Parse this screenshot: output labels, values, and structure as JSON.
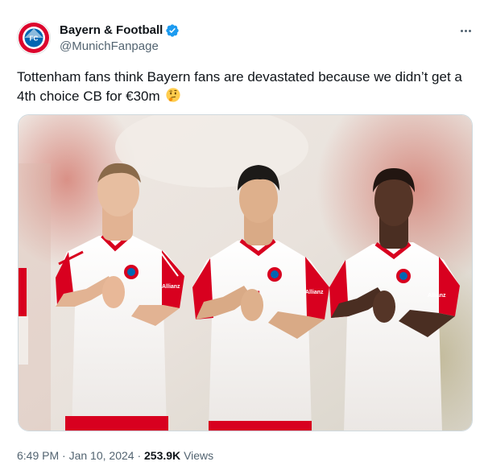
{
  "account": {
    "display_name": "Bayern & Football",
    "handle": "@MunichFanpage",
    "verified": true,
    "avatar_icon": "fc-bayern-crest-icon"
  },
  "tweet": {
    "text": "Tottenham fans think Bayern fans are devastated because we didn’t get a 4th choice CB for €30m",
    "emoji": "thinking-face-icon"
  },
  "media": {
    "description_icon": "three-players-in-red-white-kits-photo",
    "shirt_sponsor": "Allianz"
  },
  "meta": {
    "time": "6:49 PM",
    "separator": "·",
    "date": "Jan 10, 2024",
    "views_count": "253.9K",
    "views_label": "Views"
  },
  "colors": {
    "verified": "#1d9bf0",
    "kit_red": "#d8001f",
    "handle": "#536471"
  }
}
